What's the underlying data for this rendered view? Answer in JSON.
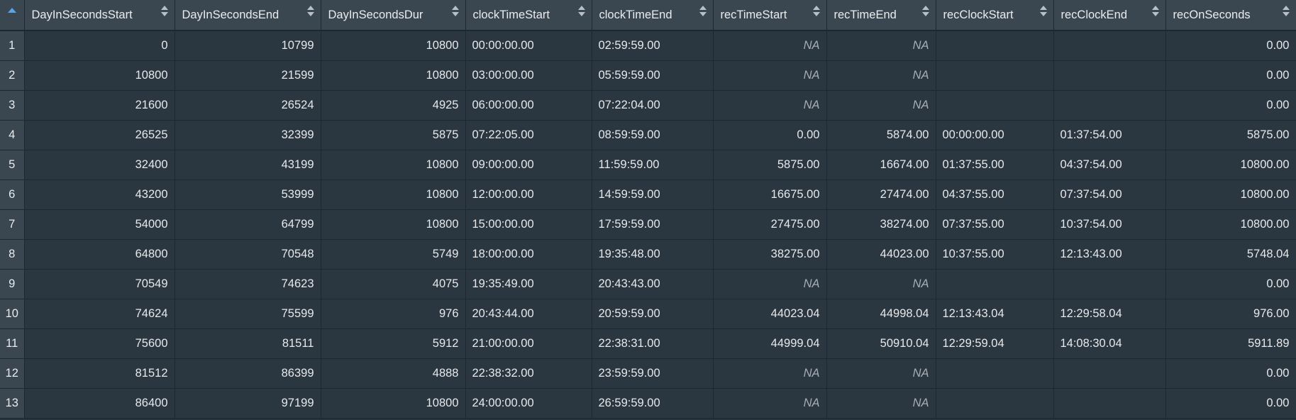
{
  "columns": [
    "DayInSecondsStart",
    "DayInSecondsEnd",
    "DayInSecondsDur",
    "clockTimeStart",
    "clockTimeEnd",
    "recTimeStart",
    "recTimeEnd",
    "recClockStart",
    "recClockEnd",
    "recOnSeconds"
  ],
  "column_align": [
    "num",
    "num",
    "num",
    "txt",
    "txt",
    "num",
    "num",
    "txt",
    "txt",
    "num"
  ],
  "rows": [
    {
      "n": "1",
      "cells": [
        "0",
        "10799",
        "10800",
        "00:00:00.00",
        "02:59:59.00",
        "NA",
        "NA",
        "",
        "",
        "0.00"
      ]
    },
    {
      "n": "2",
      "cells": [
        "10800",
        "21599",
        "10800",
        "03:00:00.00",
        "05:59:59.00",
        "NA",
        "NA",
        "",
        "",
        "0.00"
      ]
    },
    {
      "n": "3",
      "cells": [
        "21600",
        "26524",
        "4925",
        "06:00:00.00",
        "07:22:04.00",
        "NA",
        "NA",
        "",
        "",
        "0.00"
      ]
    },
    {
      "n": "4",
      "cells": [
        "26525",
        "32399",
        "5875",
        "07:22:05.00",
        "08:59:59.00",
        "0.00",
        "5874.00",
        "00:00:00.00",
        "01:37:54.00",
        "5875.00"
      ]
    },
    {
      "n": "5",
      "cells": [
        "32400",
        "43199",
        "10800",
        "09:00:00.00",
        "11:59:59.00",
        "5875.00",
        "16674.00",
        "01:37:55.00",
        "04:37:54.00",
        "10800.00"
      ]
    },
    {
      "n": "6",
      "cells": [
        "43200",
        "53999",
        "10800",
        "12:00:00.00",
        "14:59:59.00",
        "16675.00",
        "27474.00",
        "04:37:55.00",
        "07:37:54.00",
        "10800.00"
      ]
    },
    {
      "n": "7",
      "cells": [
        "54000",
        "64799",
        "10800",
        "15:00:00.00",
        "17:59:59.00",
        "27475.00",
        "38274.00",
        "07:37:55.00",
        "10:37:54.00",
        "10800.00"
      ]
    },
    {
      "n": "8",
      "cells": [
        "64800",
        "70548",
        "5749",
        "18:00:00.00",
        "19:35:48.00",
        "38275.00",
        "44023.00",
        "10:37:55.00",
        "12:13:43.00",
        "5748.04"
      ]
    },
    {
      "n": "9",
      "cells": [
        "70549",
        "74623",
        "4075",
        "19:35:49.00",
        "20:43:43.00",
        "NA",
        "NA",
        "",
        "",
        "0.00"
      ]
    },
    {
      "n": "10",
      "cells": [
        "74624",
        "75599",
        "976",
        "20:43:44.00",
        "20:59:59.00",
        "44023.04",
        "44998.04",
        "12:13:43.04",
        "12:29:58.04",
        "976.00"
      ]
    },
    {
      "n": "11",
      "cells": [
        "75600",
        "81511",
        "5912",
        "21:00:00.00",
        "22:38:31.00",
        "44999.04",
        "50910.04",
        "12:29:59.04",
        "14:08:30.04",
        "5911.89"
      ]
    },
    {
      "n": "12",
      "cells": [
        "81512",
        "86399",
        "4888",
        "22:38:32.00",
        "23:59:59.00",
        "NA",
        "NA",
        "",
        "",
        "0.00"
      ]
    },
    {
      "n": "13",
      "cells": [
        "86400",
        "97199",
        "10800",
        "24:00:00.00",
        "26:59:59.00",
        "NA",
        "NA",
        "",
        "",
        "0.00"
      ]
    }
  ],
  "colors": {
    "header_bg": "#3b4750",
    "cell_bg": "#2b3740",
    "grid": "#1c2730",
    "sort_accent": "#5aa3e8",
    "na_text": "#a5adb3"
  },
  "icons": {
    "row_number_sort": "sort-ascending-icon",
    "column_sort": "sort-toggle-icon"
  }
}
